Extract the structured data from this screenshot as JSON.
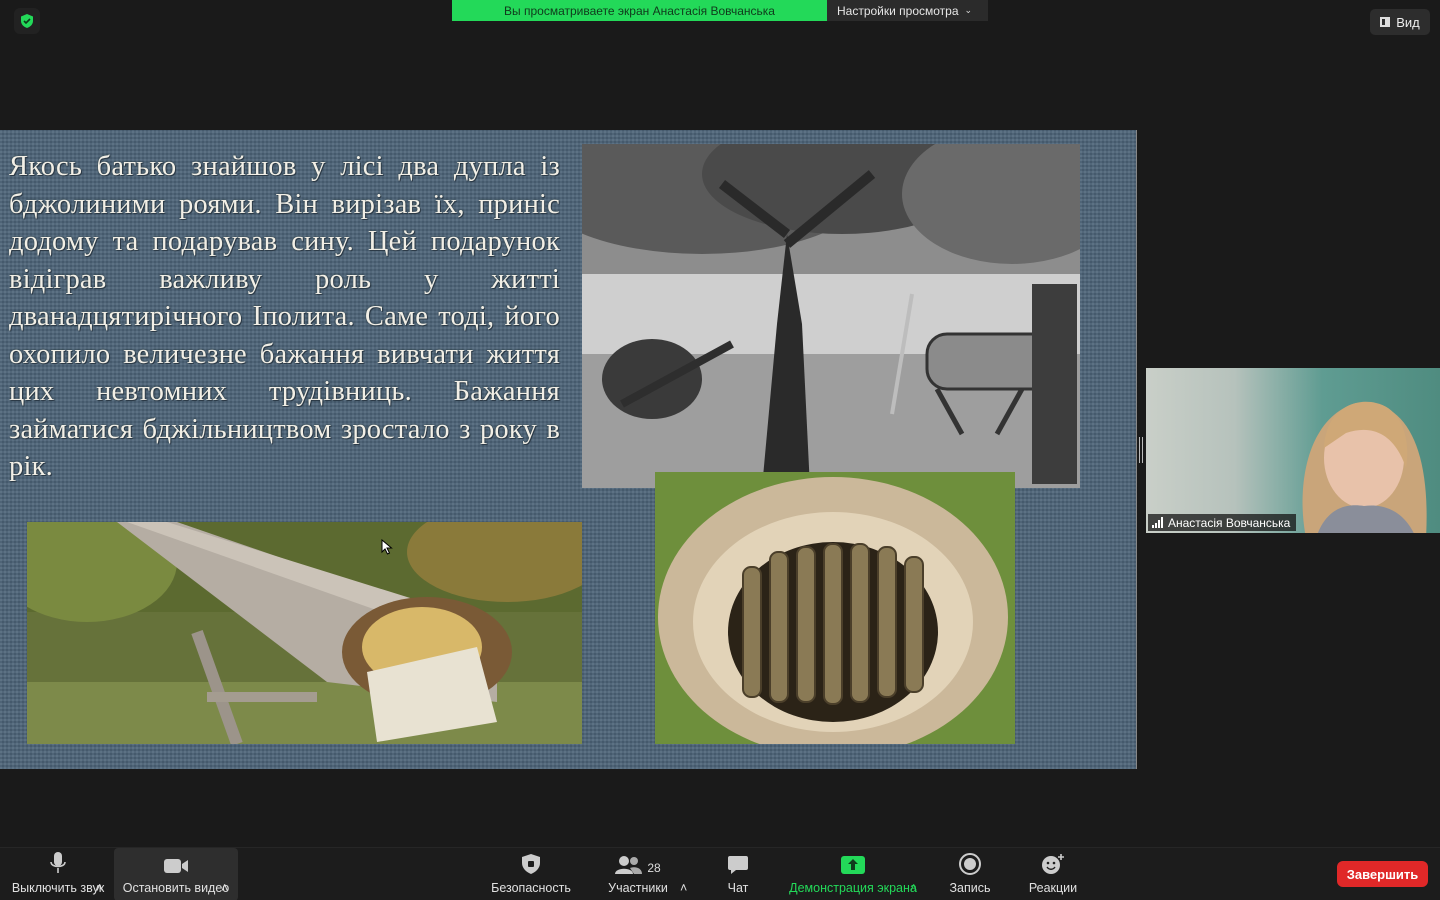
{
  "top": {
    "share_banner_text": "Вы просматриваете экран Анастасія Вовчанська",
    "view_options_label": "Настройки просмотра",
    "view_button_label": "Вид",
    "colors": {
      "banner_green": "#23d959",
      "end_red": "#e02828"
    }
  },
  "slide": {
    "text": "Якось батько знайшов у лісі два дупла із бджолиними роями. Він вирізав їх, приніс додому та подарував сину. Цей подарунок відіграв важливу роль у житті дванадцятирічного Іполита. Саме тоді, його охопило величезне бажання вивчати життя цих невтомних трудівниць. Бажання займатися бджільництвом зростало з року в рік."
  },
  "participant": {
    "name": "Анастасія Вовчанська"
  },
  "toolbar": {
    "mute_label": "Выключить звук",
    "video_label": "Остановить видео",
    "security_label": "Безопасность",
    "participants_label": "Участники",
    "participants_count": "28",
    "chat_label": "Чат",
    "share_label": "Демонстрация экрана",
    "record_label": "Запись",
    "reactions_label": "Реакции",
    "end_label": "Завершить"
  }
}
